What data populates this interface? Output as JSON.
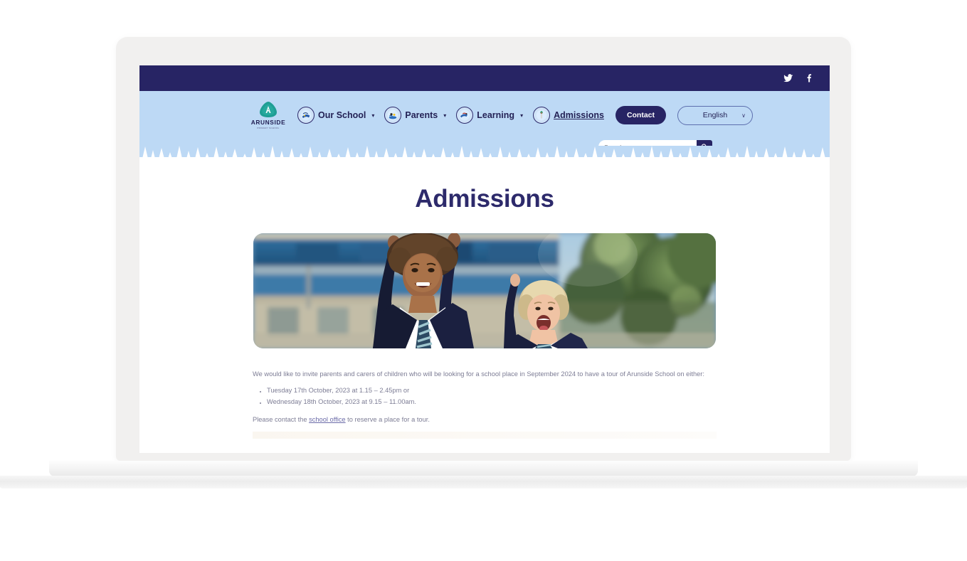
{
  "topbar": {
    "social": [
      {
        "name": "twitter-icon",
        "label": "Twitter"
      },
      {
        "name": "facebook-icon",
        "label": "Facebook"
      }
    ]
  },
  "brand": {
    "wordmark": "ARUNSIDE",
    "subtext": "PRIMARY SCHOOL",
    "mark_letter": "A",
    "mark_color": "#1f9e94"
  },
  "nav": {
    "items": [
      {
        "label": "Our School",
        "icon": "our-school-badge-icon",
        "has_caret": true,
        "underlined": false
      },
      {
        "label": "Parents",
        "icon": "parents-badge-icon",
        "has_caret": true,
        "underlined": false
      },
      {
        "label": "Learning",
        "icon": "learning-badge-icon",
        "has_caret": true,
        "underlined": false
      },
      {
        "label": "Admissions",
        "icon": "admissions-badge-icon",
        "has_caret": false,
        "underlined": true
      }
    ],
    "contact_label": "Contact",
    "caret_glyph": "▾"
  },
  "language": {
    "selected": "English",
    "caret_glyph": "∨",
    "options": [
      "English"
    ]
  },
  "search": {
    "placeholder": "Search ...",
    "value": "",
    "button_icon": "search-icon"
  },
  "page": {
    "title": "Admissions",
    "hero_alt": "Two smiling school children in navy uniforms cheering with arms raised outside the school building",
    "intro": "We would like to invite parents and carers of children who will be looking for a school place in September 2024 to have a tour of Arunside School on either:",
    "bullets": [
      "Tuesday 17th October, 2023 at 1.15 – 2.45pm or",
      "Wednesday 18th October, 2023 at 9.15 – 11.00am."
    ],
    "closing_before_link": "Please contact the ",
    "closing_link": "school office",
    "closing_after_link": " to reserve a place for a tour."
  },
  "colors": {
    "navy": "#272464",
    "header_blue": "#bdd9f5",
    "title_navy": "#2d2a6b",
    "body_text": "#7d7d95",
    "link": "#6b6ba8",
    "bezel": "#f1f0ef"
  }
}
